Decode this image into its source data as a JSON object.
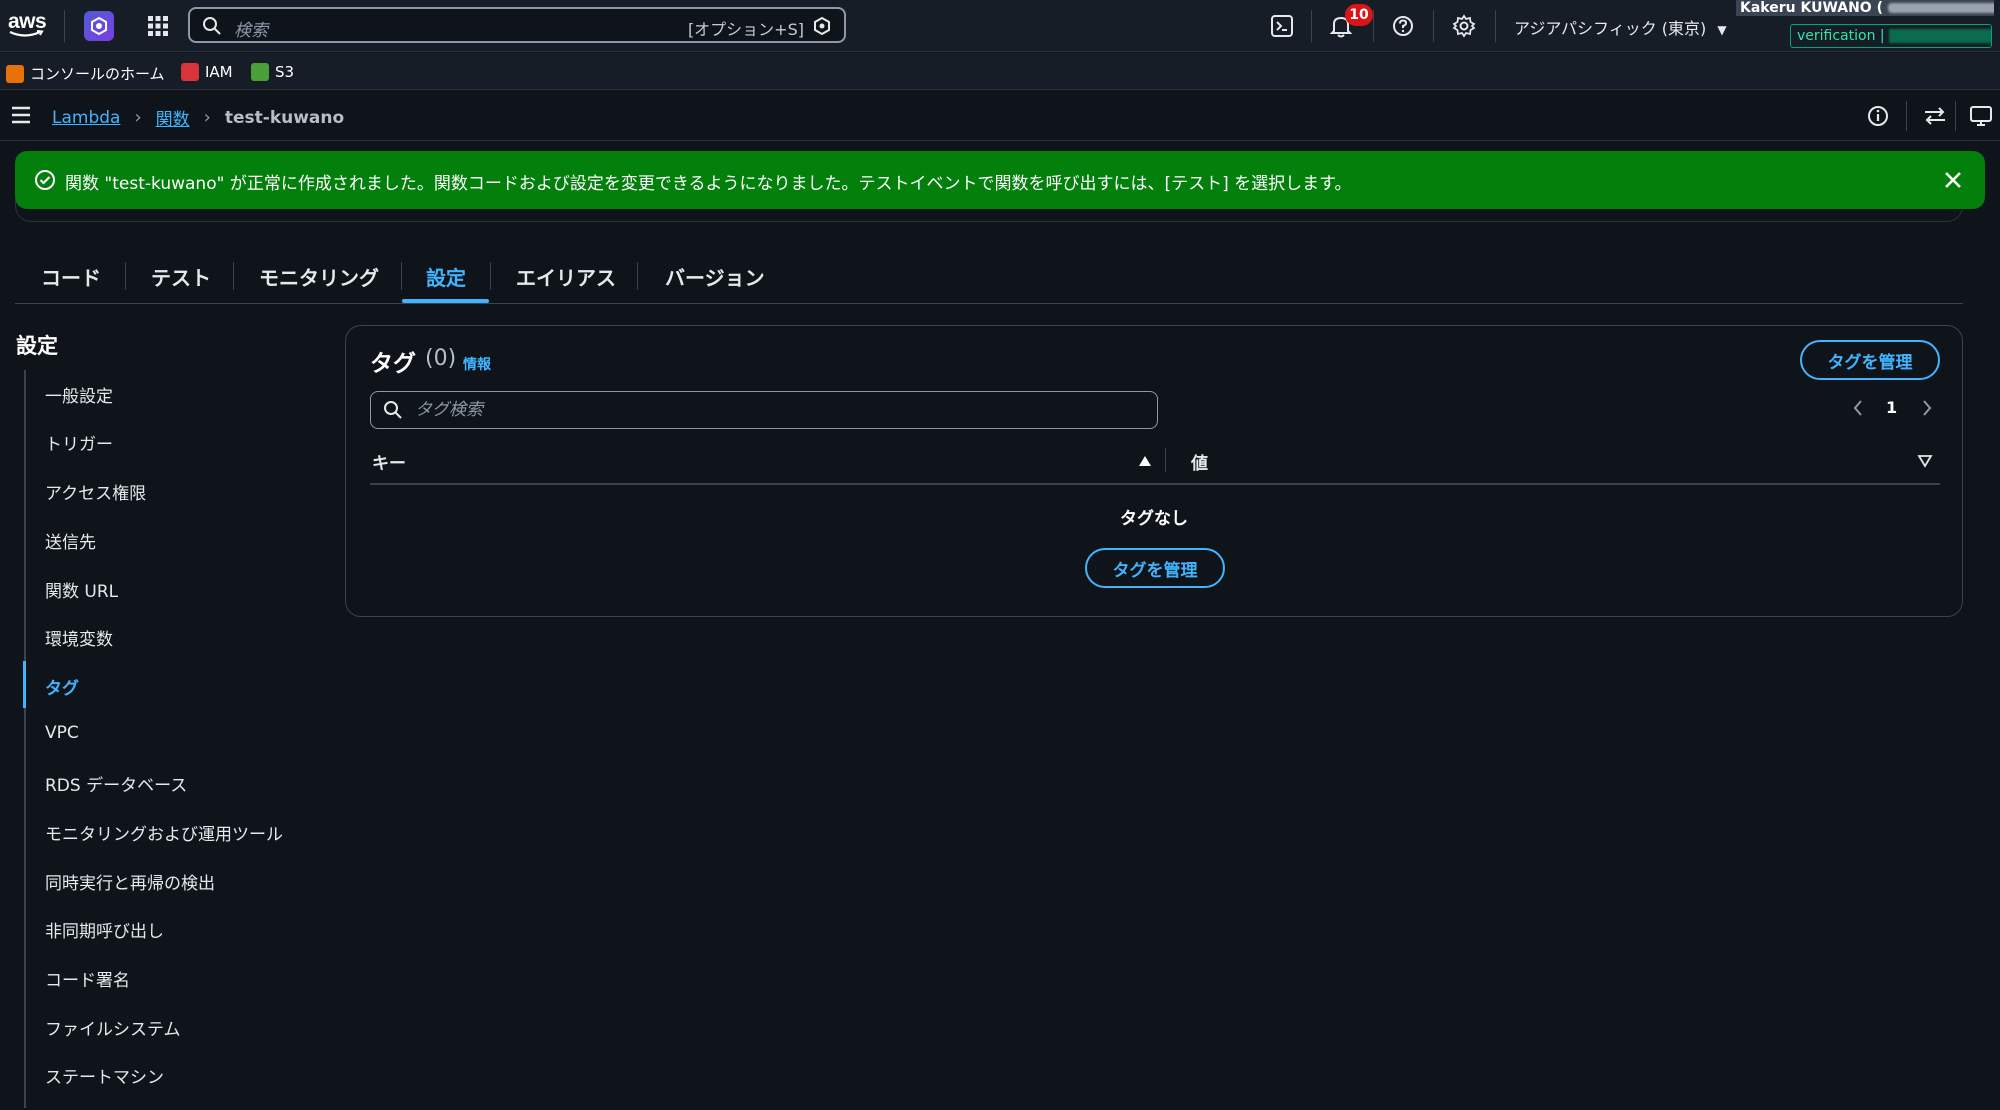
{
  "topnav": {
    "logo_text": "aws",
    "search_placeholder": "検索",
    "search_shortcut": "[オプション+S]",
    "notification_count": "10",
    "region": "アジアパシフィック (東京)",
    "account_name": "Kakeru KUWANO (",
    "verification_label": "verification |"
  },
  "favorites": [
    {
      "label": "コンソールのホーム",
      "color": "#e8710a"
    },
    {
      "label": "IAM",
      "color": "#d8343a"
    },
    {
      "label": "S3",
      "color": "#4a9f38"
    }
  ],
  "breadcrumb": {
    "items": [
      "Lambda",
      "関数"
    ],
    "current": "test-kuwano"
  },
  "flash": {
    "message": "関数 \"test-kuwano\" が正常に作成されました。関数コードおよび設定を変更できるようになりました。テストイベントで関数を呼び出すには、[テスト] を選択します。"
  },
  "tabs": [
    "コード",
    "テスト",
    "モニタリング",
    "設定",
    "エイリアス",
    "バージョン"
  ],
  "active_tab": "設定",
  "sidenav": {
    "title": "設定",
    "items": [
      "一般設定",
      "トリガー",
      "アクセス権限",
      "送信先",
      "関数 URL",
      "環境変数",
      "タグ",
      "VPC",
      "RDS データベース",
      "モニタリングおよび運用ツール",
      "同時実行と再帰の検出",
      "非同期呼び出し",
      "コード署名",
      "ファイルシステム",
      "ステートマシン"
    ],
    "active": "タグ"
  },
  "tags_panel": {
    "title": "タグ",
    "count": "(0)",
    "info_link": "情報",
    "manage_button": "タグを管理",
    "search_placeholder": "タグ検索",
    "page": "1",
    "columns": [
      "キー",
      "値"
    ],
    "empty_text": "タグなし",
    "empty_button": "タグを管理"
  },
  "colors": {
    "accent": "#42b4ff",
    "success": "#037f0c",
    "background": "#0f141a",
    "nav_background": "#161d26",
    "badge": "#d91515"
  }
}
